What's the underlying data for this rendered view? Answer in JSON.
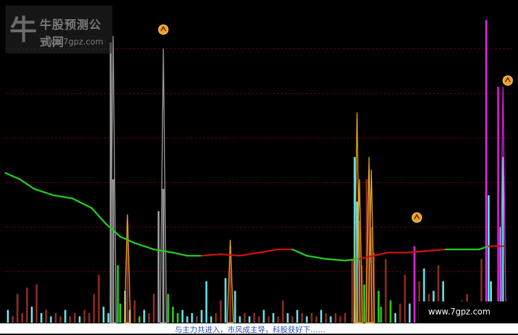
{
  "watermark": {
    "title": "牛股预测公式网",
    "url": "www.7gpz.com"
  },
  "site_badge": "www.7gpz.com",
  "caption": "与主力共进入，市风成主导，科股获好下……",
  "colors": {
    "background": "#000000",
    "grid": "#7a0000",
    "avg_line_green": "#22cc22",
    "avg_line_red": "#cc1111",
    "bar_brown": "#8b2b20",
    "bar_cyan": "#66e0e8",
    "bar_green": "#22cc22",
    "bar_gray": "#9a9a9a",
    "bar_magenta": "#dd22dd",
    "spike_orange": "#e0a020",
    "signal_marker": "#f0a020"
  },
  "chart_data": {
    "type": "bar",
    "ylim": [
      0,
      100
    ],
    "gridlines": [
      16,
      30,
      44,
      58,
      72,
      86
    ],
    "avg_line": [
      {
        "i": 0,
        "v": 47,
        "c": "green"
      },
      {
        "i": 6,
        "v": 45,
        "c": "green"
      },
      {
        "i": 12,
        "v": 42,
        "c": "green"
      },
      {
        "i": 20,
        "v": 40,
        "c": "green"
      },
      {
        "i": 28,
        "v": 39,
        "c": "green"
      },
      {
        "i": 36,
        "v": 36,
        "c": "green"
      },
      {
        "i": 42,
        "v": 31,
        "c": "green"
      },
      {
        "i": 48,
        "v": 27,
        "c": "green"
      },
      {
        "i": 54,
        "v": 25,
        "c": "green"
      },
      {
        "i": 62,
        "v": 23,
        "c": "green"
      },
      {
        "i": 70,
        "v": 22,
        "c": "green"
      },
      {
        "i": 76,
        "v": 21,
        "c": "green"
      },
      {
        "i": 82,
        "v": 21,
        "c": "red"
      },
      {
        "i": 90,
        "v": 21.5,
        "c": "red"
      },
      {
        "i": 98,
        "v": 21,
        "c": "red"
      },
      {
        "i": 106,
        "v": 22,
        "c": "red"
      },
      {
        "i": 114,
        "v": 23,
        "c": "red"
      },
      {
        "i": 120,
        "v": 23,
        "c": "green"
      },
      {
        "i": 126,
        "v": 21,
        "c": "green"
      },
      {
        "i": 134,
        "v": 20,
        "c": "green"
      },
      {
        "i": 142,
        "v": 19.5,
        "c": "green"
      },
      {
        "i": 148,
        "v": 20,
        "c": "red"
      },
      {
        "i": 154,
        "v": 21,
        "c": "red"
      },
      {
        "i": 160,
        "v": 22,
        "c": "red"
      },
      {
        "i": 168,
        "v": 22,
        "c": "red"
      },
      {
        "i": 176,
        "v": 22.5,
        "c": "red"
      },
      {
        "i": 184,
        "v": 23,
        "c": "green"
      },
      {
        "i": 192,
        "v": 23,
        "c": "green"
      },
      {
        "i": 198,
        "v": 23,
        "c": "green"
      },
      {
        "i": 202,
        "v": 24,
        "c": "red"
      },
      {
        "i": 208,
        "v": 24,
        "c": "red"
      }
    ],
    "bars": [
      {
        "i": 1,
        "v": 4,
        "c": "cyan"
      },
      {
        "i": 3,
        "v": 2,
        "c": "brown"
      },
      {
        "i": 5,
        "v": 9,
        "c": "brown"
      },
      {
        "i": 7,
        "v": 3,
        "c": "brown"
      },
      {
        "i": 9,
        "v": 11,
        "c": "brown"
      },
      {
        "i": 11,
        "v": 5,
        "c": "cyan"
      },
      {
        "i": 13,
        "v": 12,
        "c": "brown"
      },
      {
        "i": 15,
        "v": 3,
        "c": "cyan"
      },
      {
        "i": 17,
        "v": 4,
        "c": "brown"
      },
      {
        "i": 19,
        "v": 2,
        "c": "cyan"
      },
      {
        "i": 21,
        "v": 3,
        "c": "brown"
      },
      {
        "i": 23,
        "v": 2,
        "c": "brown"
      },
      {
        "i": 25,
        "v": 4,
        "c": "cyan"
      },
      {
        "i": 27,
        "v": 2,
        "c": "brown"
      },
      {
        "i": 29,
        "v": 3,
        "c": "brown"
      },
      {
        "i": 31,
        "v": 2,
        "c": "cyan"
      },
      {
        "i": 33,
        "v": 4,
        "c": "brown"
      },
      {
        "i": 35,
        "v": 3,
        "c": "brown"
      },
      {
        "i": 37,
        "v": 9,
        "c": "brown"
      },
      {
        "i": 39,
        "v": 15,
        "c": "brown"
      },
      {
        "i": 41,
        "v": 5,
        "c": "cyan"
      },
      {
        "i": 43,
        "v": 3,
        "c": "cyan"
      },
      {
        "i": 44,
        "v": 88,
        "c": "gray"
      },
      {
        "i": 45,
        "v": 45,
        "c": "gray"
      },
      {
        "i": 47,
        "v": 18,
        "c": "green"
      },
      {
        "i": 48,
        "v": 6,
        "c": "green"
      },
      {
        "i": 50,
        "v": 10,
        "c": "cyan"
      },
      {
        "i": 51,
        "v": 32,
        "c": "brown"
      },
      {
        "i": 52,
        "v": 4,
        "c": "cyan"
      },
      {
        "i": 54,
        "v": 7,
        "c": "brown"
      },
      {
        "i": 56,
        "v": 2,
        "c": "green"
      },
      {
        "i": 58,
        "v": 4,
        "c": "cyan"
      },
      {
        "i": 60,
        "v": 3,
        "c": "brown"
      },
      {
        "i": 62,
        "v": 9,
        "c": "brown"
      },
      {
        "i": 64,
        "v": 35,
        "c": "gray"
      },
      {
        "i": 66,
        "v": 42,
        "c": "gray"
      },
      {
        "i": 68,
        "v": 9,
        "c": "green"
      },
      {
        "i": 70,
        "v": 5,
        "c": "green"
      },
      {
        "i": 72,
        "v": 3,
        "c": "green"
      },
      {
        "i": 74,
        "v": 4,
        "c": "cyan"
      },
      {
        "i": 76,
        "v": 2,
        "c": "cyan"
      },
      {
        "i": 78,
        "v": 3,
        "c": "cyan"
      },
      {
        "i": 80,
        "v": 2,
        "c": "brown"
      },
      {
        "i": 82,
        "v": 4,
        "c": "cyan"
      },
      {
        "i": 84,
        "v": 13,
        "c": "cyan"
      },
      {
        "i": 86,
        "v": 2,
        "c": "cyan"
      },
      {
        "i": 88,
        "v": 3,
        "c": "brown"
      },
      {
        "i": 90,
        "v": 7,
        "c": "brown"
      },
      {
        "i": 92,
        "v": 14,
        "c": "cyan"
      },
      {
        "i": 94,
        "v": 24,
        "c": "brown"
      },
      {
        "i": 96,
        "v": 10,
        "c": "cyan"
      },
      {
        "i": 98,
        "v": 2,
        "c": "cyan"
      },
      {
        "i": 100,
        "v": 3,
        "c": "brown"
      },
      {
        "i": 102,
        "v": 2,
        "c": "cyan"
      },
      {
        "i": 104,
        "v": 3,
        "c": "brown"
      },
      {
        "i": 106,
        "v": 2,
        "c": "brown"
      },
      {
        "i": 108,
        "v": 4,
        "c": "cyan"
      },
      {
        "i": 110,
        "v": 2,
        "c": "brown"
      },
      {
        "i": 112,
        "v": 3,
        "c": "cyan"
      },
      {
        "i": 114,
        "v": 2,
        "c": "brown"
      },
      {
        "i": 116,
        "v": 7,
        "c": "brown"
      },
      {
        "i": 118,
        "v": 3,
        "c": "cyan"
      },
      {
        "i": 120,
        "v": 2,
        "c": "brown"
      },
      {
        "i": 122,
        "v": 4,
        "c": "cyan"
      },
      {
        "i": 124,
        "v": 3,
        "c": "brown"
      },
      {
        "i": 126,
        "v": 2,
        "c": "cyan"
      },
      {
        "i": 128,
        "v": 3,
        "c": "brown"
      },
      {
        "i": 130,
        "v": 2,
        "c": "brown"
      },
      {
        "i": 132,
        "v": 4,
        "c": "cyan"
      },
      {
        "i": 134,
        "v": 3,
        "c": "brown"
      },
      {
        "i": 136,
        "v": 2,
        "c": "cyan"
      },
      {
        "i": 138,
        "v": 3,
        "c": "brown"
      },
      {
        "i": 140,
        "v": 2,
        "c": "brown"
      },
      {
        "i": 142,
        "v": 3,
        "c": "brown"
      },
      {
        "i": 145,
        "v": 20,
        "c": "brown"
      },
      {
        "i": 146,
        "v": 52,
        "c": "cyan"
      },
      {
        "i": 147,
        "v": 38,
        "c": "cyan"
      },
      {
        "i": 148,
        "v": 32,
        "c": "brown"
      },
      {
        "i": 149,
        "v": 18,
        "c": "brown"
      },
      {
        "i": 150,
        "v": 12,
        "c": "green"
      },
      {
        "i": 151,
        "v": 45,
        "c": "brown"
      },
      {
        "i": 152,
        "v": 48,
        "c": "brown"
      },
      {
        "i": 153,
        "v": 30,
        "c": "brown"
      },
      {
        "i": 154,
        "v": 22,
        "c": "brown"
      },
      {
        "i": 156,
        "v": 10,
        "c": "green"
      },
      {
        "i": 157,
        "v": 5,
        "c": "green"
      },
      {
        "i": 159,
        "v": 20,
        "c": "brown"
      },
      {
        "i": 161,
        "v": 7,
        "c": "green"
      },
      {
        "i": 163,
        "v": 3,
        "c": "cyan"
      },
      {
        "i": 165,
        "v": 6,
        "c": "brown"
      },
      {
        "i": 167,
        "v": 15,
        "c": "brown"
      },
      {
        "i": 169,
        "v": 6,
        "c": "cyan"
      },
      {
        "i": 171,
        "v": 24,
        "c": "magenta"
      },
      {
        "i": 173,
        "v": 13,
        "c": "brown"
      },
      {
        "i": 175,
        "v": 17,
        "c": "cyan"
      },
      {
        "i": 177,
        "v": 9,
        "c": "brown"
      },
      {
        "i": 179,
        "v": 10,
        "c": "cyan"
      },
      {
        "i": 181,
        "v": 18,
        "c": "brown"
      },
      {
        "i": 183,
        "v": 13,
        "c": "cyan"
      },
      {
        "i": 185,
        "v": 4,
        "c": "brown"
      },
      {
        "i": 187,
        "v": 3,
        "c": "cyan"
      },
      {
        "i": 189,
        "v": 5,
        "c": "brown"
      },
      {
        "i": 191,
        "v": 7,
        "c": "brown"
      },
      {
        "i": 193,
        "v": 9,
        "c": "brown"
      },
      {
        "i": 195,
        "v": 6,
        "c": "cyan"
      },
      {
        "i": 197,
        "v": 4,
        "c": "cyan"
      },
      {
        "i": 199,
        "v": 20,
        "c": "brown"
      },
      {
        "i": 201,
        "v": 95,
        "c": "magenta"
      },
      {
        "i": 202,
        "v": 40,
        "c": "cyan"
      },
      {
        "i": 203,
        "v": 13,
        "c": "cyan"
      },
      {
        "i": 205,
        "v": 6,
        "c": "brown"
      },
      {
        "i": 206,
        "v": 74,
        "c": "magenta"
      },
      {
        "i": 207,
        "v": 30,
        "c": "cyan"
      },
      {
        "i": 208,
        "v": 52,
        "c": "cyan"
      }
    ],
    "spikes": [
      {
        "i": 45,
        "v": 90,
        "c": "gray"
      },
      {
        "i": 51,
        "v": 34,
        "c": "orange"
      },
      {
        "i": 66,
        "v": 86,
        "c": "gray"
      },
      {
        "i": 94,
        "v": 26,
        "c": "orange"
      },
      {
        "i": 147,
        "v": 66,
        "c": "orange"
      },
      {
        "i": 148,
        "v": 45,
        "c": "orange"
      },
      {
        "i": 152,
        "v": 52,
        "c": "orange"
      },
      {
        "i": 153,
        "v": 48,
        "c": "orange"
      },
      {
        "i": 208,
        "v": 74,
        "c": "magenta"
      }
    ],
    "signals": [
      {
        "i": 66,
        "v": 92
      },
      {
        "i": 172,
        "v": 33
      },
      {
        "i": 210,
        "v": 76
      }
    ],
    "n": 212
  }
}
